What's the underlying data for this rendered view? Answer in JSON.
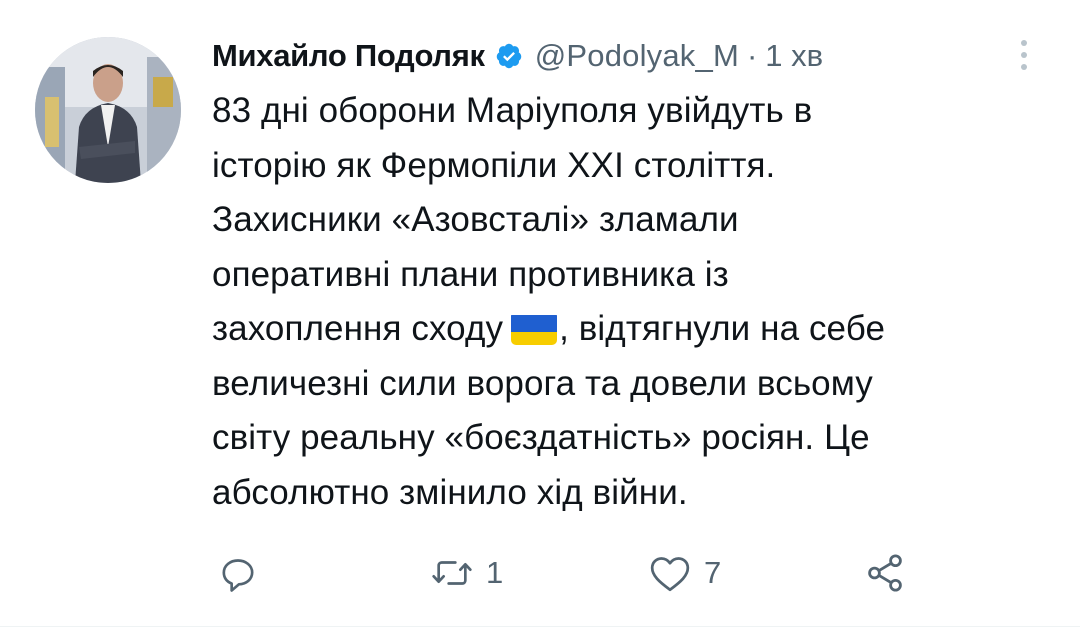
{
  "tweet": {
    "author": {
      "name": "Михайло Подоляк",
      "handle": "@Podolyak_M",
      "verified": true,
      "avatar": "avatar-photo"
    },
    "separator": "·",
    "time": "1 хв",
    "more_icon": "more-vertical-icon",
    "text_lines": [
      "83 дні оборони Маріуполя увійдуть в",
      "історію як Фермопіли XXI століття.",
      "Захисники «Азовсталі» зламали",
      "оперативні плани противника із",
      "захоплення сходу",
      ", відтягнули на себе",
      "величезні сили ворога та довели всьому",
      "світу реальну «боєздатність» росіян. Це",
      "абсолютно змінило хід війни."
    ],
    "flag_emoji": "ukraine-flag",
    "actions": {
      "reply": {
        "icon": "reply-icon"
      },
      "retweet": {
        "icon": "retweet-icon",
        "count": "1"
      },
      "like": {
        "icon": "heart-icon",
        "count": "7"
      },
      "share": {
        "icon": "share-icon"
      }
    },
    "colors": {
      "text": "#0f1419",
      "secondary": "#536471",
      "verified": "#1d9bf0",
      "flag_blue": "#1f5fd0",
      "flag_yellow": "#f7cd00"
    }
  }
}
